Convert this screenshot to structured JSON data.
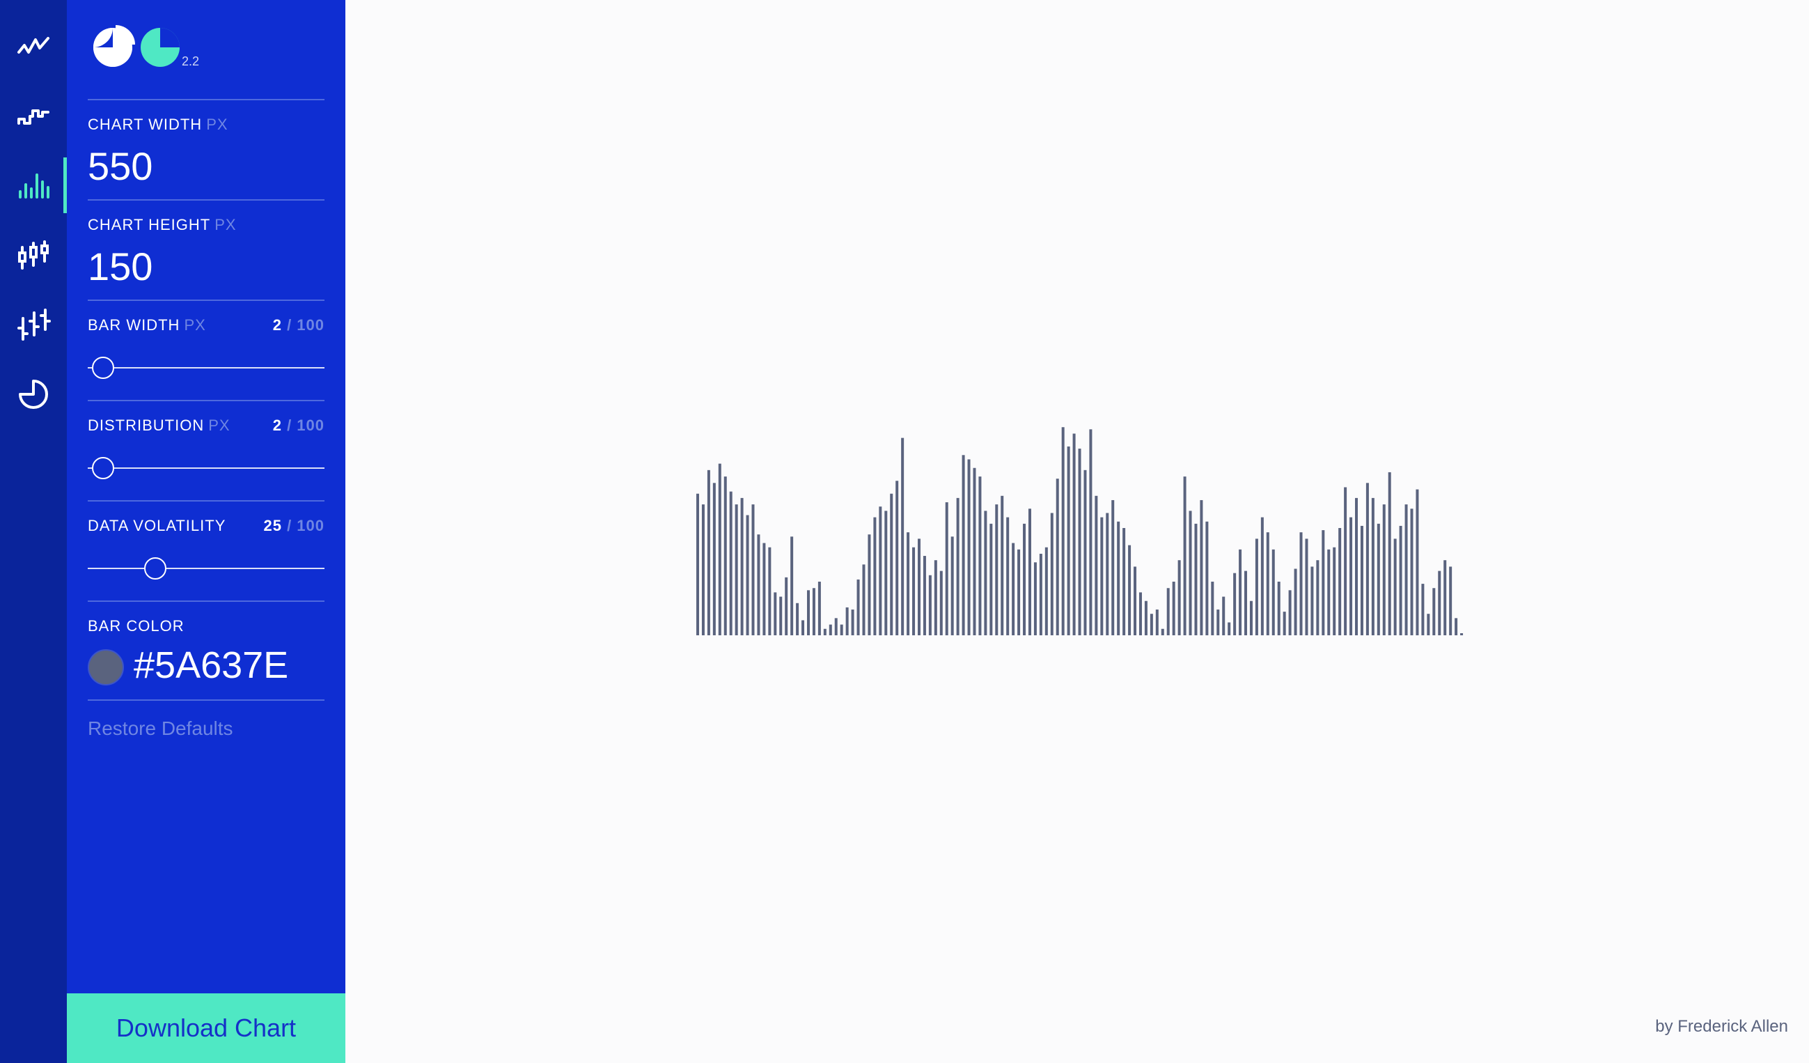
{
  "app": {
    "version": "2.2",
    "accent_color": "#4fe8c4",
    "panel_color": "#0f2ed2",
    "rail_color": "#0a249b"
  },
  "rail": {
    "items": [
      {
        "icon": "line-chart-icon",
        "active": false
      },
      {
        "icon": "step-chart-icon",
        "active": false
      },
      {
        "icon": "bar-chart-icon",
        "active": true
      },
      {
        "icon": "candlestick-chart-icon",
        "active": false
      },
      {
        "icon": "ohlc-chart-icon",
        "active": false
      },
      {
        "icon": "pie-chart-icon",
        "active": false
      }
    ]
  },
  "controls": {
    "chart_width": {
      "label": "CHART WIDTH",
      "unit": "PX",
      "value": "550"
    },
    "chart_height": {
      "label": "CHART HEIGHT",
      "unit": "PX",
      "value": "150"
    },
    "bar_width": {
      "label": "BAR WIDTH",
      "unit": "PX",
      "value": 2,
      "value_text": "2",
      "max_text": "/ 100",
      "max": 100
    },
    "distribution": {
      "label": "DISTRIBUTION",
      "unit": "PX",
      "value": 2,
      "value_text": "2",
      "max_text": "/ 100",
      "max": 100
    },
    "data_volatility": {
      "label": "DATA VOLATILITY",
      "value": 25,
      "value_text": "25",
      "max_text": "/ 100",
      "max": 100
    },
    "bar_color": {
      "label": "BAR COLOR",
      "value": "#5A637E"
    }
  },
  "actions": {
    "restore_label": "Restore Defaults",
    "download_label": "Download Chart"
  },
  "footer": {
    "credit": "by Frederick Allen"
  },
  "chart_data": {
    "type": "bar",
    "color": "#5A637E",
    "ylim": [
      0,
      100
    ],
    "values": [
      66,
      61,
      77,
      71,
      80,
      74,
      67,
      61,
      64,
      56,
      61,
      47,
      43,
      41,
      20,
      18,
      27,
      46,
      15,
      7,
      21,
      22,
      25,
      3,
      5,
      8,
      5,
      13,
      12,
      26,
      33,
      47,
      55,
      60,
      58,
      66,
      72,
      92,
      48,
      41,
      45,
      37,
      28,
      35,
      30,
      62,
      46,
      64,
      84,
      82,
      78,
      74,
      58,
      52,
      61,
      65,
      55,
      43,
      40,
      52,
      59,
      34,
      38,
      41,
      57,
      73,
      97,
      88,
      94,
      87,
      77,
      96,
      65,
      55,
      57,
      63,
      53,
      50,
      42,
      32,
      20,
      16,
      10,
      12,
      3,
      22,
      25,
      35,
      74,
      58,
      52,
      63,
      53,
      25,
      12,
      18,
      6,
      29,
      40,
      30,
      16,
      45,
      55,
      48,
      40,
      25,
      11,
      21,
      31,
      48,
      45,
      32,
      35,
      49,
      40,
      41,
      50,
      69,
      55,
      64,
      51,
      71,
      64,
      52,
      61,
      76,
      45,
      51,
      61,
      59,
      68,
      24,
      10,
      22,
      30,
      35,
      32,
      8,
      0
    ]
  }
}
